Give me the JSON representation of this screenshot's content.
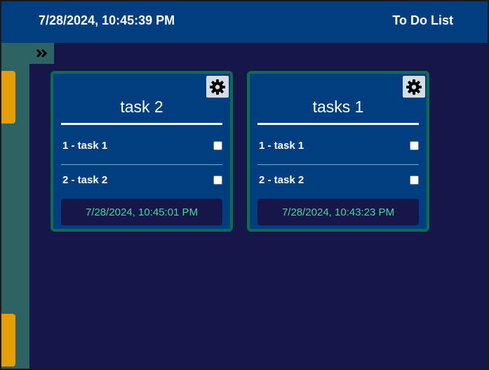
{
  "header": {
    "datetime": "7/28/2024, 10:45:39 PM",
    "title": "To Do List"
  },
  "sidebar": {
    "expand_icon": "double-chevron-right-icon"
  },
  "cards": [
    {
      "title": "task 2",
      "settings_icon": "gear-icon",
      "tasks": [
        {
          "label": "1 - task 1",
          "checked": false
        },
        {
          "label": "2 - task 2",
          "checked": false
        }
      ],
      "created": "7/28/2024, 10:45:01 PM"
    },
    {
      "title": "tasks 1",
      "settings_icon": "gear-icon",
      "tasks": [
        {
          "label": "1 - task 1",
          "checked": false
        },
        {
          "label": "2 - task 2",
          "checked": false
        }
      ],
      "created": "7/28/2024, 10:43:23 PM"
    }
  ],
  "colors": {
    "background": "#16164b",
    "header": "#003e80",
    "sidebar": "#2e6363",
    "accent_tab": "#e69e05",
    "card_border": "#0b6e4f",
    "date_text": "#3ddc97"
  }
}
